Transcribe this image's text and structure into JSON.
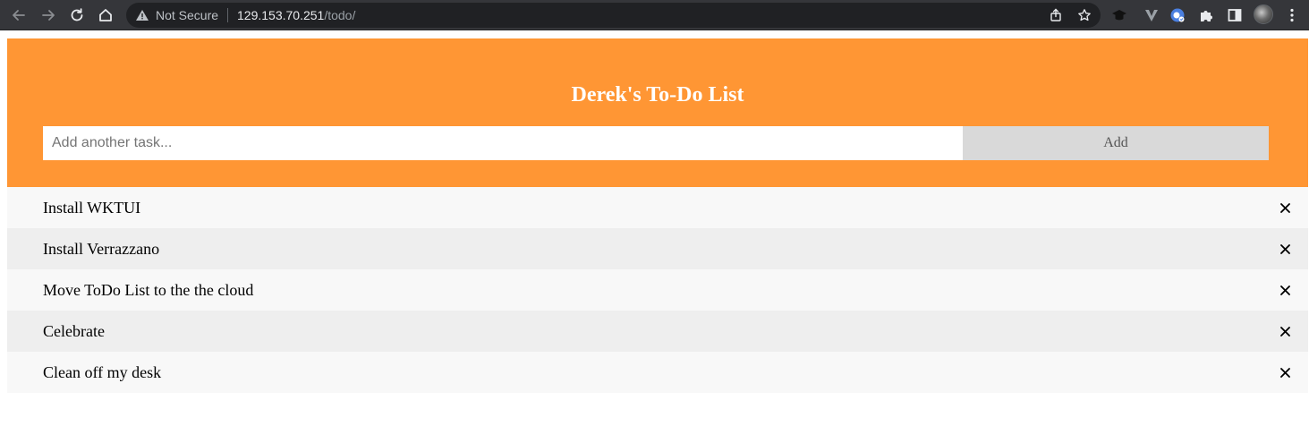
{
  "browser": {
    "security_label": "Not Secure",
    "url_host": "129.153.70.251",
    "url_path": "/todo/",
    "icons": [
      "back-icon",
      "forward-icon",
      "reload-icon",
      "home-icon",
      "warning-icon",
      "share-icon",
      "bookmark-star-icon",
      "extension-icons",
      "puzzle-icon",
      "sidebar-icon",
      "avatar",
      "more-icon"
    ]
  },
  "header": {
    "title": "Derek's To-Do List",
    "input_placeholder": "Add another task...",
    "input_value": "",
    "add_label": "Add"
  },
  "todos": [
    {
      "text": "Install WKTUI",
      "close": "×"
    },
    {
      "text": "Install Verrazzano",
      "close": "×"
    },
    {
      "text": "Move ToDo List to the the cloud",
      "close": "×"
    },
    {
      "text": "Celebrate",
      "close": "×"
    },
    {
      "text": "Clean off my desk",
      "close": "×"
    }
  ],
  "colors": {
    "header_bg": "#ff9634",
    "row_light": "#f8f8f8",
    "row_dark": "#eeeeee",
    "add_button_bg": "#d9d9d9"
  }
}
